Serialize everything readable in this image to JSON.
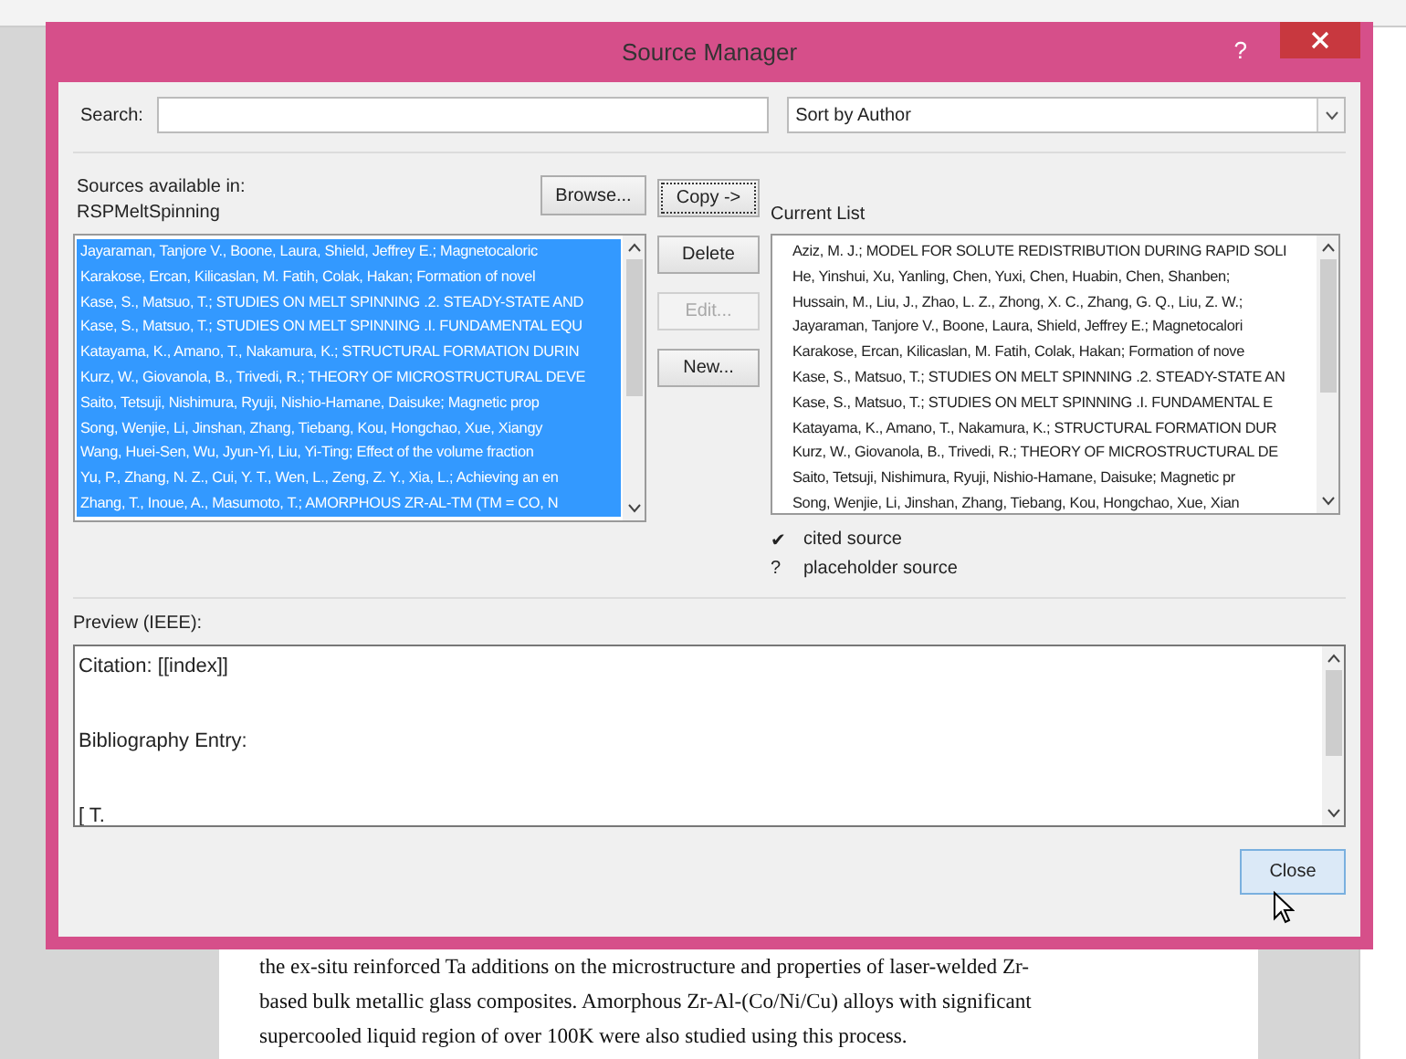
{
  "window": {
    "title": "Source Manager",
    "help": "?"
  },
  "search": {
    "label": "Search:"
  },
  "sort": {
    "value": "Sort by Author"
  },
  "sources": {
    "label": "Sources available in:",
    "location": "RSPMeltSpinning",
    "browse": "Browse...",
    "items": [
      {
        "text": "Jayaraman, Tanjore V., Boone, Laura, Shield, Jeffrey E.; Magnetocaloric",
        "selected": true
      },
      {
        "text": "Karakose, Ercan, Kilicaslan, M. Fatih, Colak, Hakan; Formation of novel",
        "selected": true
      },
      {
        "text": "Kase, S., Matsuo, T.; STUDIES ON MELT SPINNING .2. STEADY-STATE AND",
        "selected": true
      },
      {
        "text": "Kase, S., Matsuo, T.; STUDIES ON MELT SPINNING .I. FUNDAMENTAL EQU",
        "selected": true
      },
      {
        "text": "Katayama, K., Amano, T., Nakamura, K.; STRUCTURAL FORMATION DURIN",
        "selected": true
      },
      {
        "text": "Kurz, W., Giovanola, B., Trivedi, R.; THEORY OF MICROSTRUCTURAL DEVE",
        "selected": true
      },
      {
        "text": "Saito, Tetsuji, Nishimura, Ryuji, Nishio-Hamane, Daisuke; Magnetic prop",
        "selected": true
      },
      {
        "text": "Song, Wenjie, Li, Jinshan, Zhang, Tiebang, Kou, Hongchao, Xue, Xiangy",
        "selected": true
      },
      {
        "text": "Wang, Huei-Sen, Wu, Jyun-Yi, Liu, Yi-Ting; Effect of the volume fraction",
        "selected": true
      },
      {
        "text": "Yu, P., Zhang, N. Z., Cui, Y. T., Wen, L., Zeng, Z. Y., Xia, L.; Achieving an en",
        "selected": true
      },
      {
        "text": "Zhang, T., Inoue, A., Masumoto, T.; AMORPHOUS ZR-AL-TM (TM = CO, N",
        "selected": true
      }
    ]
  },
  "actions": [
    {
      "label": "Copy ->",
      "disabled": false
    },
    {
      "label": "Delete",
      "disabled": false
    },
    {
      "label": "Edit...",
      "disabled": true
    },
    {
      "label": "New...",
      "disabled": false
    }
  ],
  "current": {
    "label": "Current List",
    "items": [
      {
        "text": "Aziz, M. J.; MODEL FOR SOLUTE REDISTRIBUTION DURING RAPID SOLI",
        "selected": false
      },
      {
        "text": "He, Yinshui, Xu, Yanling, Chen, Yuxi, Chen, Huabin, Chen, Shanben;",
        "selected": false
      },
      {
        "text": "Hussain, M., Liu, J., Zhao, L. Z., Zhong, X. C., Zhang, G. Q., Liu, Z. W.;",
        "selected": false
      },
      {
        "text": "Jayaraman, Tanjore V., Boone, Laura, Shield, Jeffrey E.; Magnetocalori",
        "selected": false
      },
      {
        "text": "Karakose, Ercan, Kilicaslan, M. Fatih, Colak, Hakan; Formation of nove",
        "selected": false
      },
      {
        "text": "Kase, S., Matsuo, T.; STUDIES ON MELT SPINNING .2. STEADY-STATE AN",
        "selected": false
      },
      {
        "text": "Kase, S., Matsuo, T.; STUDIES ON MELT SPINNING .I. FUNDAMENTAL E",
        "selected": false
      },
      {
        "text": "Katayama, K., Amano, T., Nakamura, K.; STRUCTURAL FORMATION DUR",
        "selected": false
      },
      {
        "text": "Kurz, W., Giovanola, B., Trivedi, R.; THEORY OF MICROSTRUCTURAL DE",
        "selected": false
      },
      {
        "text": "Saito, Tetsuji, Nishimura, Ryuji, Nishio-Hamane, Daisuke; Magnetic pr",
        "selected": false
      },
      {
        "text": "Song, Wenjie, Li, Jinshan, Zhang, Tiebang, Kou, Hongchao, Xue, Xian",
        "selected": false
      }
    ],
    "legend": [
      {
        "mark": "✔",
        "text": "cited source"
      },
      {
        "mark": "?",
        "text": "placeholder source"
      }
    ]
  },
  "preview": {
    "label": "Preview (IEEE):",
    "lines": [
      "Citation:  [[index]]",
      "Bibliography Entry:",
      "[ T."
    ]
  },
  "close": "Close",
  "document": {
    "lines": [
      "the ex-situ reinforced Ta additions on the microstructure and properties of laser-welded Zr-",
      "based bulk metallic glass composites. Amorphous Zr-Al-(Co/Ni/Cu) alloys with significant",
      "supercooled liquid region of over 100K were also studied using this process."
    ]
  }
}
